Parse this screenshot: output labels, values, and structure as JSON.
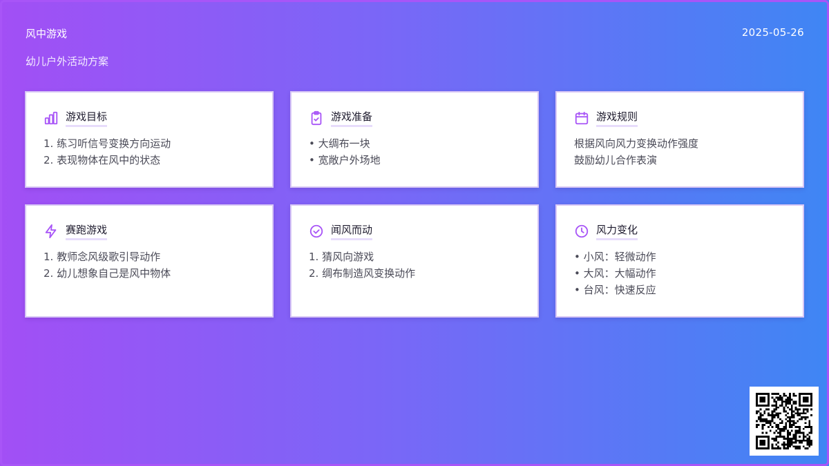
{
  "header": {
    "title": "风中游戏",
    "subtitle": "幼儿户外活动方案",
    "date": "2025-05-26"
  },
  "colors": {
    "accent": "#a855f7",
    "gradient_start": "#a24ff5",
    "gradient_end": "#3f86f4"
  },
  "cards": [
    {
      "title": "游戏目标",
      "icon": "bar-chart-icon",
      "lines": [
        "1. 练习听信号变换方向运动",
        "2. 表现物体在风中的状态"
      ]
    },
    {
      "title": "游戏准备",
      "icon": "clipboard-check-icon",
      "lines": [
        "• 大绸布一块",
        "• 宽敞户外场地"
      ]
    },
    {
      "title": "游戏规则",
      "icon": "calendar-icon",
      "lines": [
        "根据风向风力变换动作强度",
        "鼓励幼儿合作表演"
      ]
    },
    {
      "title": "赛跑游戏",
      "icon": "lightning-icon",
      "lines": [
        "1. 教师念风级歌引导动作",
        "2. 幼儿想象自己是风中物体"
      ]
    },
    {
      "title": "闻风而动",
      "icon": "check-circle-icon",
      "lines": [
        "1. 猜风向游戏",
        "2. 绸布制造风变换动作"
      ]
    },
    {
      "title": "风力变化",
      "icon": "clock-icon",
      "lines": [
        "• 小风：轻微动作",
        "• 大风：大幅动作",
        "• 台风：快速反应"
      ]
    }
  ]
}
